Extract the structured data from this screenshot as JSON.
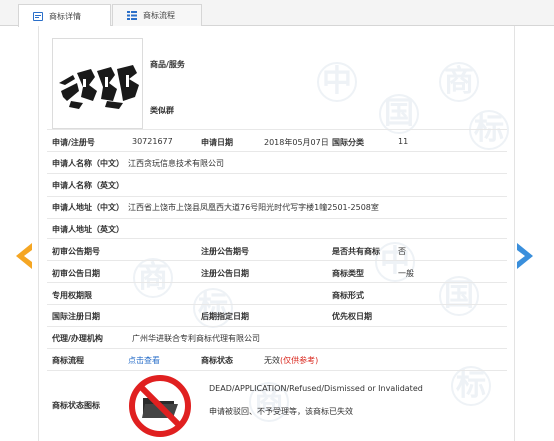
{
  "tabs": [
    {
      "label": "商标详情"
    },
    {
      "label": "商标流程"
    }
  ],
  "logo": {
    "text": "諸葛將"
  },
  "info": {
    "goods_label": "商品/服务",
    "similar_label": "类似群",
    "reg_no_label": "申请/注册号",
    "reg_no": "30721677",
    "apply_date_label": "申请日期",
    "apply_date": "2018年05月07日",
    "intl_class_label": "国际分类",
    "intl_class": "11",
    "applicant_cn_label": "申请人名称（中文）",
    "applicant_cn": "江西贪玩信息技术有限公司",
    "applicant_en_label": "申请人名称（英文）",
    "address_cn_label": "申请人地址（中文）",
    "address_cn": "江西省上饶市上饶县凤凰西大道76号阳光时代写字楼1幢2501-2508室",
    "address_en_label": "申请人地址（英文）",
    "prelim_no_label": "初审公告期号",
    "reg_pub_no_label": "注册公告期号",
    "shared_label": "是否共有商标",
    "shared_value": "否",
    "prelim_date_label": "初审公告日期",
    "reg_pub_date_label": "注册公告日期",
    "type_label": "商标类型",
    "type_value": "一般",
    "exclusive_label": "专用权期限",
    "form_label": "商标形式",
    "intl_reg_date_label": "国际注册日期",
    "later_date_label": "后期指定日期",
    "priority_date_label": "优先权日期",
    "agent_label": "代理/办理机构",
    "agent_value": "广州华进联合专利商标代理有限公司",
    "flow_label": "商标流程",
    "flow_link": "点击查看",
    "status_label": "商标状态",
    "status_value": "无效",
    "status_note": "(仅供参考)",
    "status_icon_label": "商标状态图标",
    "status_en": "DEAD/APPLICATION/Refused/Dismissed or Invalidated",
    "status_cn": "申请被驳回、不予受理等，该商标已失效"
  },
  "watermark": [
    "中",
    "国",
    "商",
    "标"
  ],
  "colors": {
    "accent": "#2a6fc9",
    "arrow_left": "#f5a623",
    "arrow_right": "#3a8fdc",
    "status_red": "#d9261c",
    "prohibit_red": "#e02020"
  }
}
